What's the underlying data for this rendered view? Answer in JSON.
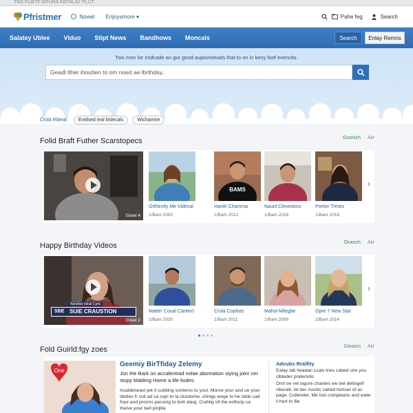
{
  "window": {
    "title_text": "TNS FLWTF MTHRA FATHLAY PLUT."
  },
  "header": {
    "logo_text": "Pfristmer",
    "nav": [
      {
        "label": "Nowel"
      },
      {
        "label": "Enjoysmore ▾"
      }
    ],
    "links": [
      {
        "label": "Pahe feg"
      },
      {
        "label": "Search"
      }
    ]
  },
  "navbar": {
    "items": [
      "Salatey Ublee",
      "Viduo",
      "Stipt News",
      "Bandhows",
      "Moncals"
    ],
    "search_label": "Search",
    "enjoy_label": "Enlay Remns"
  },
  "hero": {
    "tagline": "Tois mon for irsdcade an gur good aupionsleads that to on in keny foof evencits.",
    "search_placeholder": "Geadl tlher ihoutien to om noed ae lbrthday.."
  },
  "filters": {
    "label": "Crola Ribeat",
    "chips": [
      "Evidsed leal lirdecals",
      "Wichamire"
    ]
  },
  "section1": {
    "title": "Folid Braft Futher Scarstopecs",
    "link_green": "Goonich",
    "link_gray": "Alir",
    "feature_badge": "Greel 4",
    "items": [
      {
        "caption": "Orthently Me Videcal",
        "meta": "1/Bam 2002"
      },
      {
        "caption": "Harith  Chamma",
        "meta": "1/Bam 2012"
      },
      {
        "caption": "Nauril Clevestors",
        "meta": "1/Bam 2016"
      },
      {
        "caption": "Portier Trmes",
        "meta": "1/Bam 2016"
      }
    ],
    "shirt_text": "BAMS"
  },
  "section2": {
    "title": "Happy Birthday Videos",
    "link_green": "Onanch",
    "link_gray": "Alir",
    "feature_badge": "Greel 2",
    "overlay_small": "Nandlas Iolcal Caric",
    "overlay_big": "SUIE CRAUSTION",
    "overlay_tag": "SBE",
    "items": [
      {
        "caption": "Matter Coual Cantecl",
        "meta": "1/Bam 2020"
      },
      {
        "caption": "Crola Coplists",
        "meta": "1/Bam 2011"
      },
      {
        "caption": "Mahol Mileglar",
        "meta": "1/Bam 2009"
      },
      {
        "caption": "Opre 7 New Star",
        "meta": "1/Bam 2014"
      }
    ]
  },
  "section3": {
    "title": "Fold Guirld:fgy zoes",
    "link_green": "Gouscn",
    "link_gray": "Alir",
    "heart_text": "One",
    "card_title": "Geemiy BirTfiday Zelemy",
    "card_lead": "Jon the Bark on accalentrad nolae abomation siying joinr cer stopy blalding Home a life liodes.",
    "card_body": "Acaldeneast jek it sutlding sonterss to youl. Morve your and ue your dietles fr cuil ad sa sujn to la cluistome. chings wege to he olide cad foye and pronns pecsing to bolt starg. Crahlig oll the enflorip ca Iheive your bell pinjlila",
    "side_title": "Adcubs Rralfity",
    "side_p1": "Ealay /ab headan ccals tries cabed cire you clbleder prateristic.",
    "side_p2": "Orst oe vel sigure chantes we bel delingefl nberaiil. lid ber moctic vahed horlser of as page. Collender, Me lost coinpleans and wate il hert to lile"
  }
}
